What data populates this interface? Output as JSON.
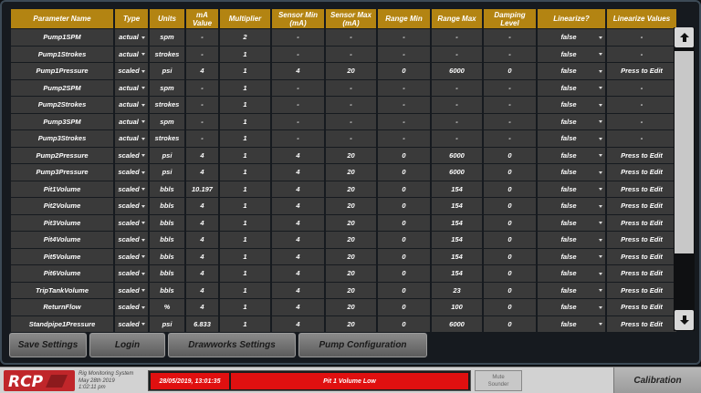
{
  "table": {
    "headers": [
      "Parameter Name",
      "Type",
      "Units",
      "mA Value",
      "Multiplier",
      "Sensor Min (mA)",
      "Sensor Max (mA)",
      "Range Min",
      "Range Max",
      "Damping Level",
      "Linearize?",
      "Linearize Values"
    ],
    "rows": [
      [
        "Pump1SPM",
        "actual",
        "spm",
        "-",
        "2",
        "-",
        "-",
        "-",
        "-",
        "-",
        "false",
        "-"
      ],
      [
        "Pump1Strokes",
        "actual",
        "strokes",
        "-",
        "1",
        "-",
        "-",
        "-",
        "-",
        "-",
        "false",
        "-"
      ],
      [
        "Pump1Pressure",
        "scaled",
        "psi",
        "4",
        "1",
        "4",
        "20",
        "0",
        "6000",
        "0",
        "false",
        "Press to Edit"
      ],
      [
        "Pump2SPM",
        "actual",
        "spm",
        "-",
        "1",
        "-",
        "-",
        "-",
        "-",
        "-",
        "false",
        "-"
      ],
      [
        "Pump2Strokes",
        "actual",
        "strokes",
        "-",
        "1",
        "-",
        "-",
        "-",
        "-",
        "-",
        "false",
        "-"
      ],
      [
        "Pump3SPM",
        "actual",
        "spm",
        "-",
        "1",
        "-",
        "-",
        "-",
        "-",
        "-",
        "false",
        "-"
      ],
      [
        "Pump3Strokes",
        "actual",
        "strokes",
        "-",
        "1",
        "-",
        "-",
        "-",
        "-",
        "-",
        "false",
        "-"
      ],
      [
        "Pump2Pressure",
        "scaled",
        "psi",
        "4",
        "1",
        "4",
        "20",
        "0",
        "6000",
        "0",
        "false",
        "Press to Edit"
      ],
      [
        "Pump3Pressure",
        "scaled",
        "psi",
        "4",
        "1",
        "4",
        "20",
        "0",
        "6000",
        "0",
        "false",
        "Press to Edit"
      ],
      [
        "Pit1Volume",
        "scaled",
        "bbls",
        "10.197",
        "1",
        "4",
        "20",
        "0",
        "154",
        "0",
        "false",
        "Press to Edit"
      ],
      [
        "Pit2Volume",
        "scaled",
        "bbls",
        "4",
        "1",
        "4",
        "20",
        "0",
        "154",
        "0",
        "false",
        "Press to Edit"
      ],
      [
        "Pit3Volume",
        "scaled",
        "bbls",
        "4",
        "1",
        "4",
        "20",
        "0",
        "154",
        "0",
        "false",
        "Press to Edit"
      ],
      [
        "Pit4Volume",
        "scaled",
        "bbls",
        "4",
        "1",
        "4",
        "20",
        "0",
        "154",
        "0",
        "false",
        "Press to Edit"
      ],
      [
        "Pit5Volume",
        "scaled",
        "bbls",
        "4",
        "1",
        "4",
        "20",
        "0",
        "154",
        "0",
        "false",
        "Press to Edit"
      ],
      [
        "Pit6Volume",
        "scaled",
        "bbls",
        "4",
        "1",
        "4",
        "20",
        "0",
        "154",
        "0",
        "false",
        "Press to Edit"
      ],
      [
        "TripTankVolume",
        "scaled",
        "bbls",
        "4",
        "1",
        "4",
        "20",
        "0",
        "23",
        "0",
        "false",
        "Press to Edit"
      ],
      [
        "ReturnFlow",
        "scaled",
        "%",
        "4",
        "1",
        "4",
        "20",
        "0",
        "100",
        "0",
        "false",
        "Press to Edit"
      ],
      [
        "Standpipe1Pressure",
        "scaled",
        "psi",
        "6.833",
        "1",
        "4",
        "20",
        "0",
        "6000",
        "0",
        "false",
        "Press to Edit"
      ]
    ]
  },
  "scrollbar": {
    "up_icon": "arrow-up-icon",
    "down_icon": "arrow-down-icon"
  },
  "actions": {
    "save_settings": "Save Settings",
    "login": "Login",
    "drawworks_settings": "Drawworks Settings",
    "pump_configuration": "Pump Configuration"
  },
  "status_bar": {
    "logo_text": "RCP",
    "system_name": "Rig Monitoring System",
    "date_line": "May 28th 2019",
    "time_line": "1:02:11 pm",
    "alarm_timestamp": "28/05/2019, 13:01:35",
    "alarm_message": "Pit 1 Volume Low",
    "mute_line1": "Mute",
    "mute_line2": "Sounder",
    "calibration": "Calibration"
  },
  "colors": {
    "header_gold": "#b38412",
    "cell_gray": "#3a3a3a",
    "alarm_red": "#e01010",
    "logo_red": "#c0262a"
  }
}
